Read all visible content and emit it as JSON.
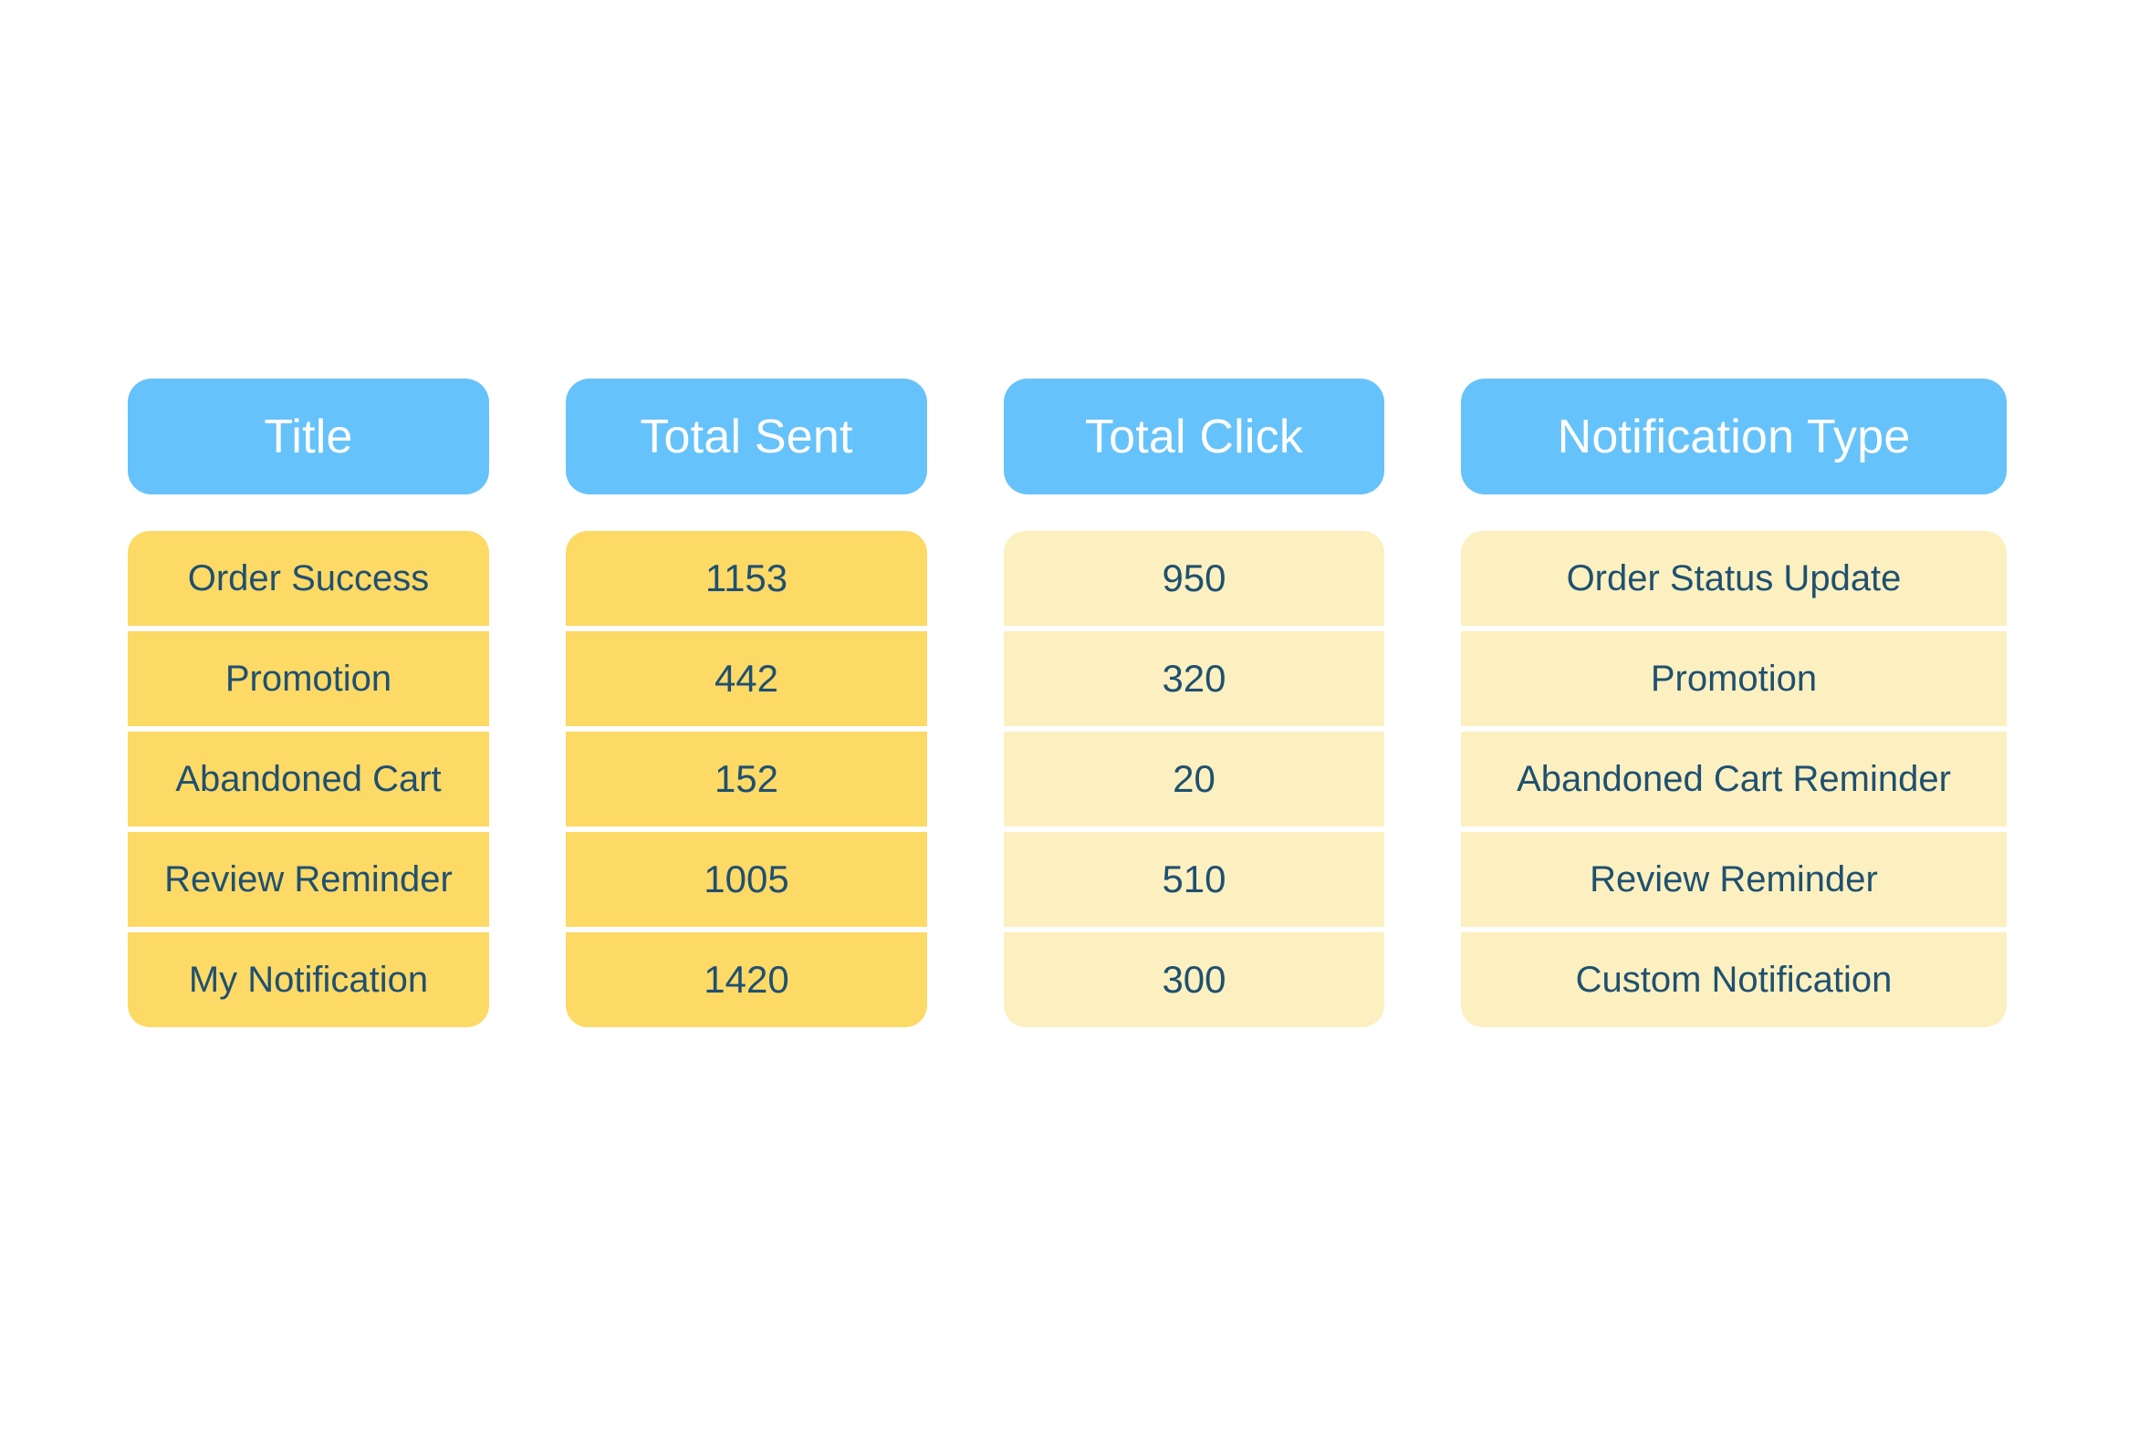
{
  "chart_data": {
    "type": "table",
    "title": "",
    "columns": [
      {
        "label": "Title",
        "align": "center",
        "tone": "strong"
      },
      {
        "label": "Total Sent",
        "align": "center",
        "tone": "strong"
      },
      {
        "label": "Total Click",
        "align": "center",
        "tone": "soft"
      },
      {
        "label": "Notification Type",
        "align": "center",
        "tone": "soft"
      }
    ],
    "rows": [
      [
        "Order Success",
        "1153",
        "950",
        "Order Status Update"
      ],
      [
        "Promotion",
        "442",
        "320",
        "Promotion"
      ],
      [
        "Abandoned Cart",
        "152",
        "20",
        "Abandoned Cart Reminder"
      ],
      [
        "Review Reminder",
        "1005",
        "510",
        "Review Reminder"
      ],
      [
        "My Notification",
        "1420",
        "300",
        "Custom Notification"
      ]
    ],
    "series": [
      {
        "name": "Total Sent",
        "values": [
          1153,
          442,
          152,
          1005,
          1420
        ]
      },
      {
        "name": "Total Click",
        "values": [
          950,
          320,
          20,
          510,
          300
        ]
      }
    ],
    "categories": [
      "Order Success",
      "Promotion",
      "Abandoned Cart",
      "Review Reminder",
      "My Notification"
    ],
    "legend": [],
    "grid": false,
    "colors": {
      "background": "#FFFFFF",
      "header_fill": "#66C2FA",
      "header_text": "#FFFFFF",
      "cell_fill_strong": "#FDD966",
      "cell_fill_soft": "#FCF0C0",
      "cell_text": "#1F5070"
    }
  }
}
